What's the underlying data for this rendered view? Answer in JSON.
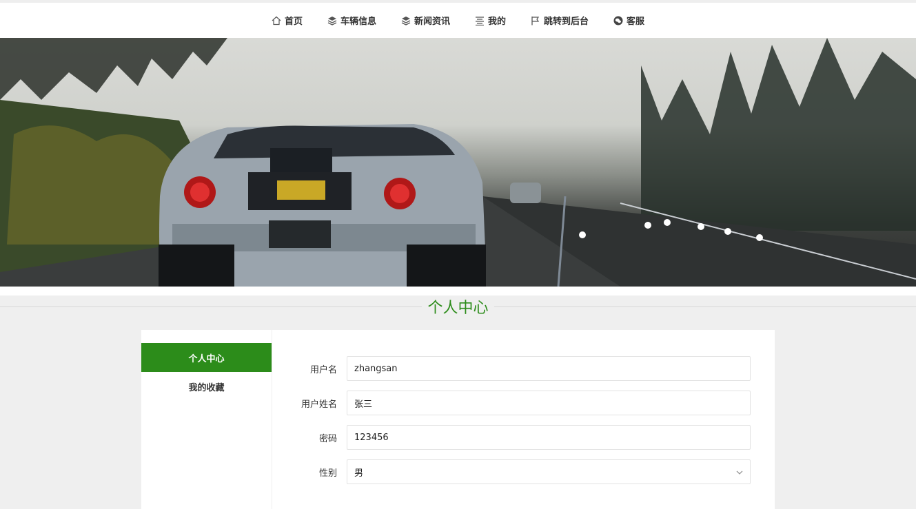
{
  "nav": {
    "items": [
      {
        "label": "首页",
        "icon": "home-icon"
      },
      {
        "label": "车辆信息",
        "icon": "layers-icon"
      },
      {
        "label": "新闻资讯",
        "icon": "layers-icon"
      },
      {
        "label": "我的",
        "icon": "list-icon"
      },
      {
        "label": "跳转到后台",
        "icon": "flag-icon"
      },
      {
        "label": "客服",
        "icon": "wechat-icon"
      }
    ]
  },
  "section": {
    "title": "个人中心"
  },
  "sidebar": {
    "items": [
      {
        "label": "个人中心",
        "active": true
      },
      {
        "label": "我的收藏",
        "active": false
      }
    ]
  },
  "form": {
    "username_label": "用户名",
    "username_value": "zhangsan",
    "fullname_label": "用户姓名",
    "fullname_value": "张三",
    "password_label": "密码",
    "password_value": "123456",
    "gender_label": "性别",
    "gender_value": "男"
  },
  "colors": {
    "accent": "#2c8c1a"
  }
}
